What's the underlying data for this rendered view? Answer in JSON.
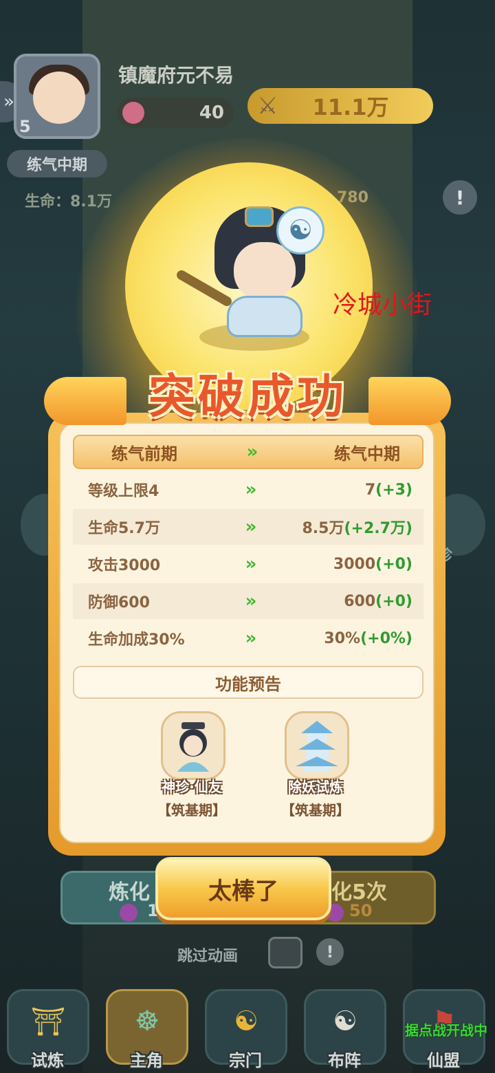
{
  "player": {
    "name": "镇魔府元不易",
    "level": "5",
    "stamina": "40",
    "power": "11.1万",
    "realm": "练气中期",
    "hp_label": "生命：8.1万",
    "def_value": "780"
  },
  "watermark": "冷城小街",
  "side_right_label": "珍",
  "dialog": {
    "title": "突破成功",
    "header": {
      "from": "练气前期",
      "to": "练气中期"
    },
    "rows": [
      {
        "left": "等级上限4",
        "right": "7",
        "gain": "(+3)"
      },
      {
        "left": "生命5.7万",
        "right": "8.5万",
        "gain": "(+2.7万)"
      },
      {
        "left": "攻击3000",
        "right": "3000",
        "gain": "(+0)"
      },
      {
        "left": "防御600",
        "right": "600",
        "gain": "(+0)"
      },
      {
        "left": "生命加成30%",
        "right": "30%",
        "gain": "(+0%)"
      }
    ],
    "preview_title": "功能预告",
    "features": [
      {
        "name": "神珍·仙友",
        "requirement": "【筑基期】",
        "icon": "immortal-friend-icon"
      },
      {
        "name": "除妖试炼",
        "requirement": "【筑基期】",
        "icon": "pagoda-icon"
      }
    ],
    "confirm_label": "太棒了"
  },
  "refine": {
    "left_label": "炼化",
    "left_cost": "1",
    "right_label": "化5次",
    "right_cost": "50"
  },
  "skip": {
    "label": "跳过动画",
    "info": "!"
  },
  "nav": {
    "items": [
      {
        "label": "试炼",
        "icon": "trial-icon"
      },
      {
        "label": "主角",
        "icon": "hero-icon"
      },
      {
        "label": "宗门",
        "icon": "sect-icon"
      },
      {
        "label": "布阵",
        "icon": "formation-icon"
      },
      {
        "label": "仙盟",
        "icon": "alliance-icon"
      }
    ],
    "alliance_badge": "据点战开战中"
  },
  "colors": {
    "accent_orange": "#e8582b",
    "gain_green": "#2f9c30",
    "panel_gold": "#f6c157"
  }
}
